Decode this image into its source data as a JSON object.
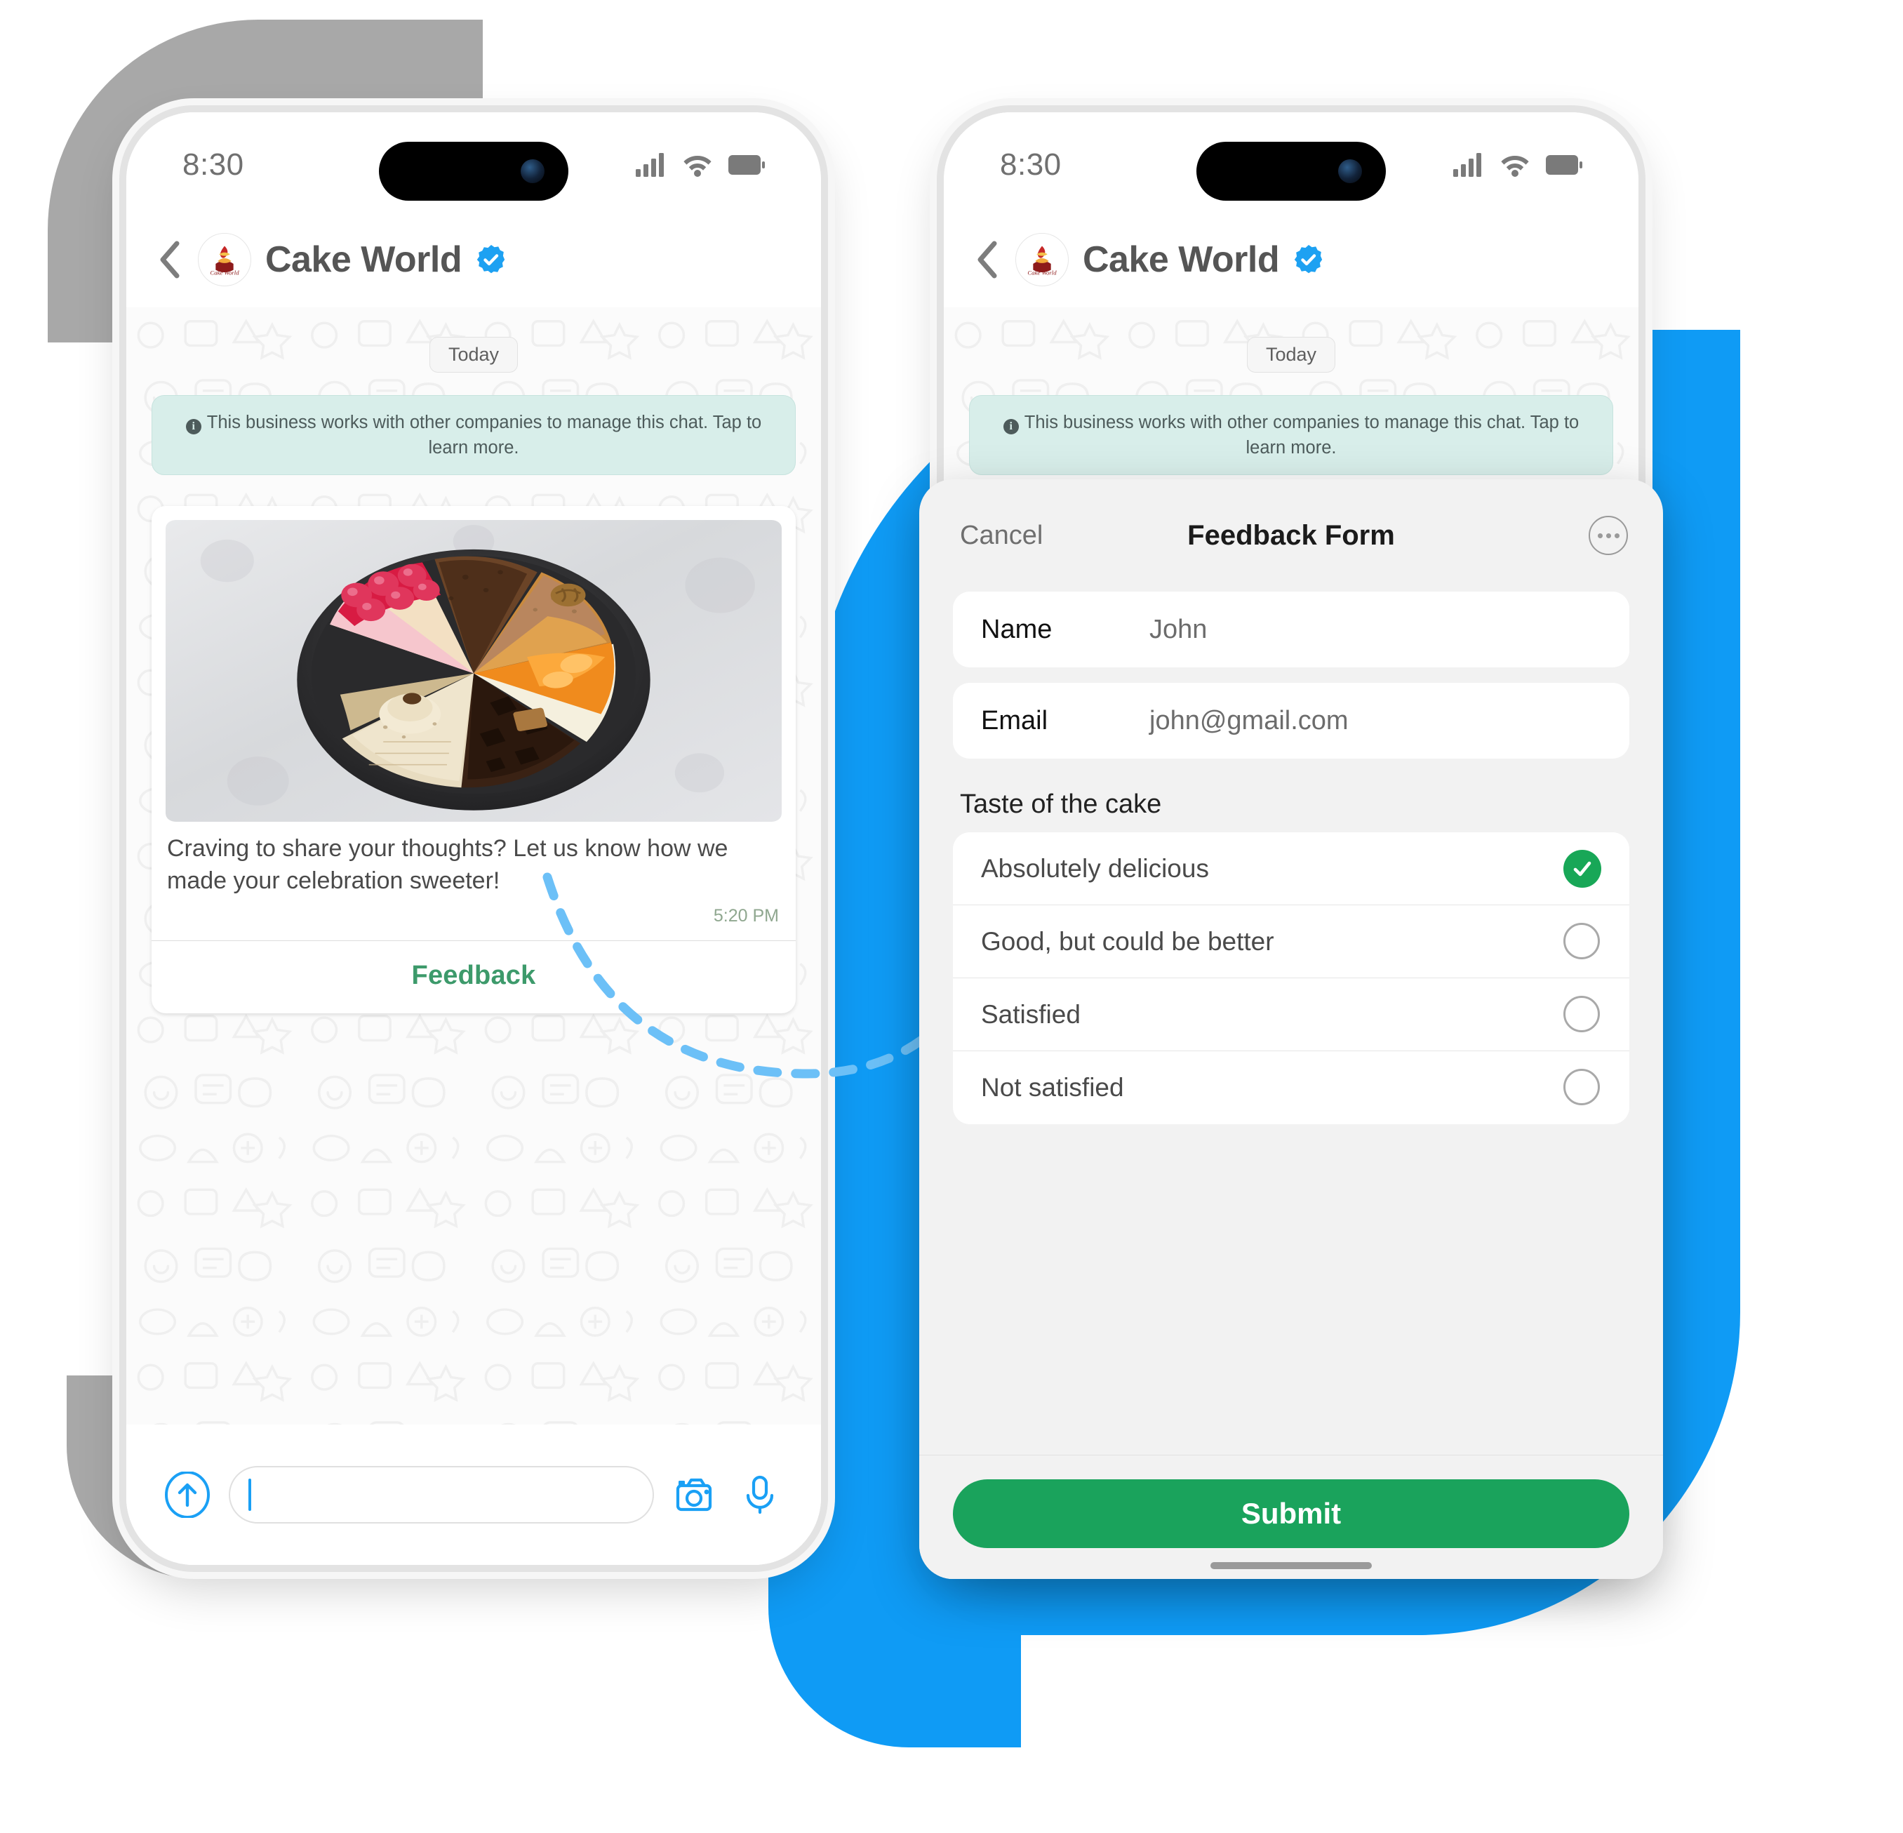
{
  "colors": {
    "accent_blue": "#0f9bf5",
    "brand_green": "#1aa35c",
    "feedback_green": "#3d9a6b",
    "banner_teal": "#d8eeea",
    "gray_blob": "#a8a8a8",
    "verified_blue": "#1da1f2"
  },
  "status_bar": {
    "time": "8:30",
    "icons": [
      "cellular-signal-icon",
      "wifi-icon",
      "battery-icon"
    ]
  },
  "chat": {
    "back_icon": "back-chevron-icon",
    "avatar_icon": "cake-world-logo",
    "title": "Cake World",
    "verified_icon": "verified-badge-icon",
    "day_separator": "Today",
    "system_banner": "This business works with other companies to manage this chat. Tap to learn more.",
    "system_banner_icon": "info-icon",
    "message": {
      "image_alt": "plate-of-assorted-cake-slices",
      "text": "Craving to share your thoughts? Let us know how we made your celebration sweeter!",
      "time": "5:20 PM",
      "action_label": "Feedback"
    },
    "composer": {
      "plus_icon": "plus-circle-icon",
      "input_value": "",
      "input_placeholder": "",
      "camera_icon": "camera-icon",
      "mic_icon": "microphone-icon"
    }
  },
  "feedback_sheet": {
    "cancel_label": "Cancel",
    "title": "Feedback Form",
    "more_icon": "more-options-icon",
    "fields": [
      {
        "label": "Name",
        "value": "John"
      },
      {
        "label": "Email",
        "value": "john@gmail.com"
      }
    ],
    "group_title": "Taste of the cake",
    "options": [
      {
        "label": "Absolutely delicious",
        "selected": true
      },
      {
        "label": "Good, but could be better",
        "selected": false
      },
      {
        "label": "Satisfied",
        "selected": false
      },
      {
        "label": "Not satisfied",
        "selected": false
      }
    ],
    "submit_label": "Submit"
  }
}
